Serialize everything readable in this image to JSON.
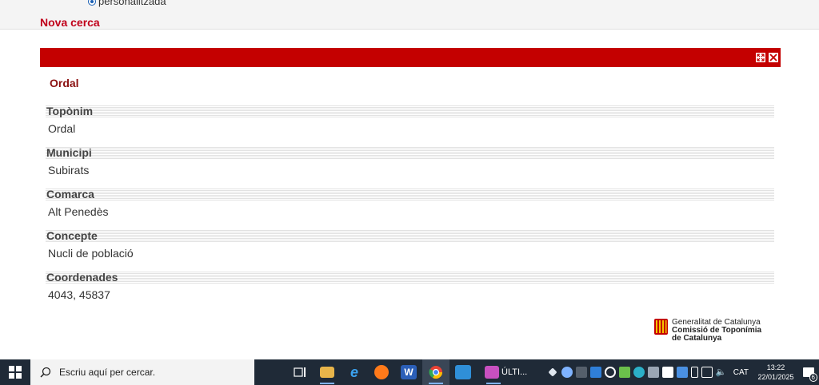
{
  "top": {
    "radio_label": "personalitzada",
    "new_search": "Nova cerca"
  },
  "panel": {
    "title": "Ordal",
    "fields": [
      {
        "label": "Topònim",
        "value": "Ordal"
      },
      {
        "label": "Municipi",
        "value": "Subirats"
      },
      {
        "label": "Comarca",
        "value": "Alt Penedès"
      },
      {
        "label": "Concepte",
        "value": "Nucli de població"
      },
      {
        "label": "Coordenades",
        "value": "4043, 45837"
      }
    ],
    "colors": {
      "bar": "#c40000",
      "title": "#8b1010",
      "link": "#c0001a"
    }
  },
  "logo": {
    "line1": "Generalitat de Catalunya",
    "line2": "Comissió de Toponímia",
    "line3": "de Catalunya"
  },
  "taskbar": {
    "search_placeholder": "Escriu aquí per cercar.",
    "app_label": "ÚLTI...",
    "language": "CAT",
    "time": "13:22",
    "date": "22/01/2025",
    "notification_count": "6"
  }
}
